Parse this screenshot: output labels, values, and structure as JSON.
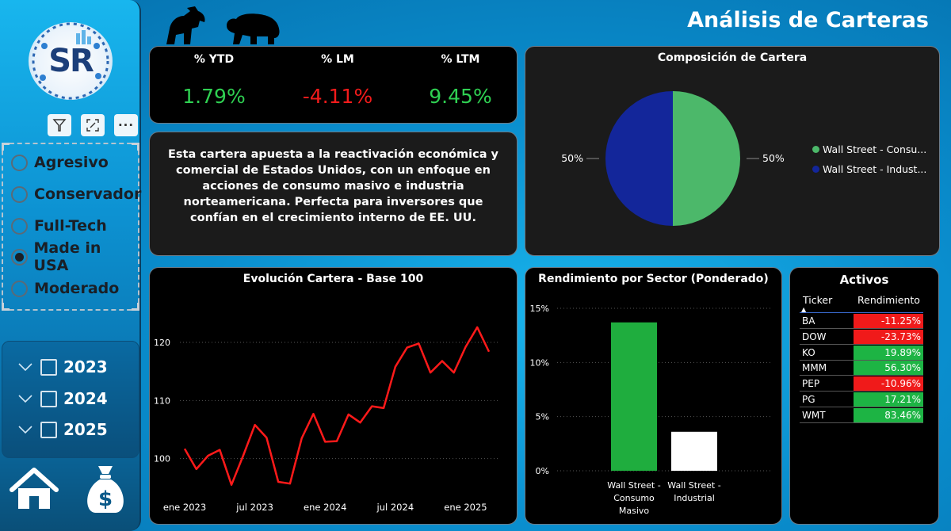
{
  "header": {
    "title": "Análisis de Carteras",
    "bull_icon": "bull-icon",
    "bear_icon": "bear-icon"
  },
  "logo": {
    "text": "SR"
  },
  "toolbar": {
    "filter_icon": "filter-icon",
    "focus_icon": "focus-mode-icon",
    "more_label": "···"
  },
  "portfolio_slicer": {
    "options": [
      {
        "label": "Agresivo",
        "selected": false
      },
      {
        "label": "Conservador",
        "selected": false
      },
      {
        "label": "Full-Tech",
        "selected": false
      },
      {
        "label": "Made in USA",
        "selected": true
      },
      {
        "label": "Moderado",
        "selected": false
      }
    ]
  },
  "year_slicer": {
    "years": [
      "2023",
      "2024",
      "2025"
    ]
  },
  "nav": {
    "home_icon": "home-icon",
    "money_icon": "money-bag-icon",
    "money_symbol": "$"
  },
  "kpis": [
    {
      "label": "% YTD",
      "value": "1.79%",
      "color": "#2fd052"
    },
    {
      "label": "% LM",
      "value": "-4.11%",
      "color": "#f21b1b"
    },
    {
      "label": "% LTM",
      "value": "9.45%",
      "color": "#2fd052"
    }
  ],
  "description": "Esta cartera apuesta a la reactivación económica y comercial de Estados Unidos, con un enfoque en acciones de consumo masivo e industria norteamericana. Perfecta para inversores que confían en el crecimiento interno de EE. UU.",
  "composition": {
    "title": "Composición de Cartera",
    "legend": [
      {
        "label": "Wall Street - Consu...",
        "color": "#4cb86a"
      },
      {
        "label": "Wall Street - Indust...",
        "color": "#13269a"
      }
    ]
  },
  "activos": {
    "title": "Activos",
    "headers": [
      "Ticker",
      "Rendimiento"
    ],
    "rows": [
      {
        "ticker": "BA",
        "value": "-11.25%",
        "color": "#f01a1a"
      },
      {
        "ticker": "DOW",
        "value": "-23.73%",
        "color": "#f01a1a"
      },
      {
        "ticker": "KO",
        "value": "19.89%",
        "color": "#1db444"
      },
      {
        "ticker": "MMM",
        "value": "56.30%",
        "color": "#1db444"
      },
      {
        "ticker": "PEP",
        "value": "-10.96%",
        "color": "#f01a1a"
      },
      {
        "ticker": "PG",
        "value": "17.21%",
        "color": "#1db444"
      },
      {
        "ticker": "WMT",
        "value": "83.46%",
        "color": "#1db444"
      }
    ]
  },
  "chart_data": [
    {
      "type": "pie",
      "title": "Composición de Cartera",
      "categories": [
        "Wall Street - Consumo Masivo",
        "Wall Street - Industrial"
      ],
      "values": [
        50,
        50
      ],
      "data_labels": [
        "50%",
        "50%"
      ],
      "colors": [
        "#4cb86a",
        "#13269a"
      ],
      "legend": "right"
    },
    {
      "type": "line",
      "title": "Evolución Cartera - Base 100",
      "x": [
        "2023-01",
        "2023-02",
        "2023-03",
        "2023-04",
        "2023-05",
        "2023-06",
        "2023-07",
        "2023-08",
        "2023-09",
        "2023-10",
        "2023-11",
        "2023-12",
        "2024-01",
        "2024-02",
        "2024-03",
        "2024-04",
        "2024-05",
        "2024-06",
        "2024-07",
        "2024-08",
        "2024-09",
        "2024-10",
        "2024-11",
        "2024-12",
        "2025-01",
        "2025-02",
        "2025-03"
      ],
      "values": [
        101.7,
        98.2,
        100.5,
        101.5,
        95.5,
        100.5,
        105.8,
        103.6,
        96.0,
        95.7,
        103.5,
        107.7,
        102.9,
        103.0,
        107.6,
        106.2,
        109.0,
        108.7,
        115.8,
        119.1,
        119.8,
        114.8,
        116.8,
        114.8,
        119.2,
        122.6,
        118.4
      ],
      "series_color": "#ff1a1a",
      "x_ticks": [
        "ene 2023",
        "jul 2023",
        "ene 2024",
        "jul 2024",
        "ene 2025"
      ],
      "x_tick_positions": [
        0,
        6,
        12,
        18,
        24
      ],
      "y_ticks": [
        100,
        110,
        120
      ],
      "ylim": [
        93,
        126
      ],
      "grid": true
    },
    {
      "type": "bar",
      "title": "Rendimiento por Sector (Ponderado)",
      "categories": [
        [
          "Wall Street -",
          "Consumo",
          "Masivo"
        ],
        [
          "Wall Street -",
          "Industrial"
        ]
      ],
      "values": [
        13.7,
        3.6
      ],
      "colors": [
        "#1fad3e",
        "#ffffff"
      ],
      "y_ticks": [
        "0%",
        "5%",
        "10%",
        "15%"
      ],
      "ylim": [
        0,
        15
      ],
      "grid": true
    }
  ]
}
